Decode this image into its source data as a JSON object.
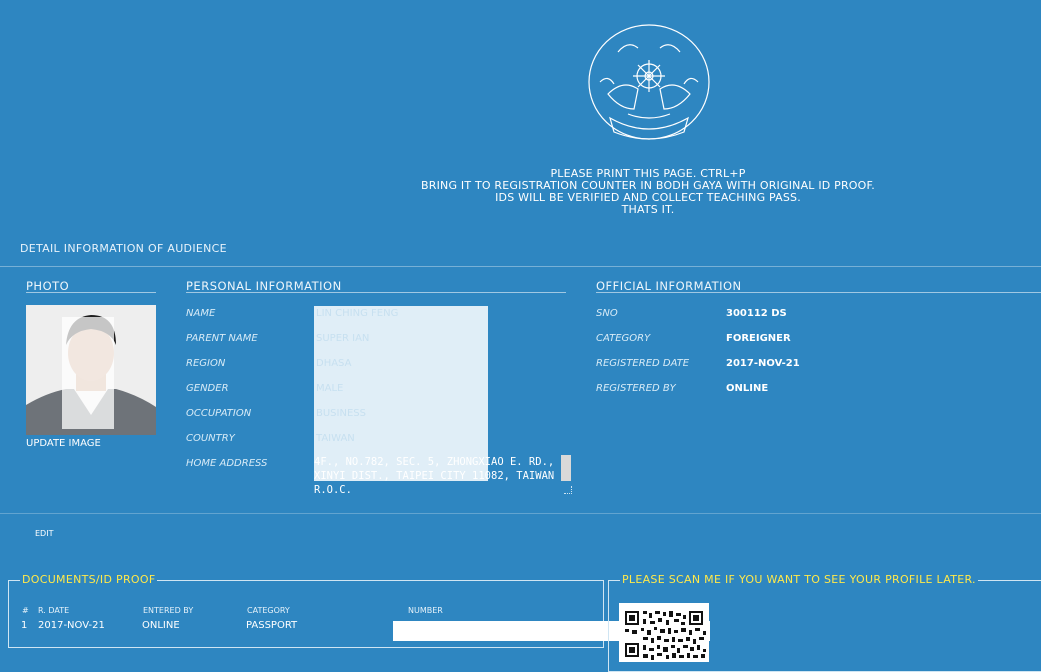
{
  "header": {
    "logo": "emblem-seal",
    "notice_lines": [
      "PLEASE PRINT THIS PAGE. CTRL+P",
      "BRING IT TO REGISTRATION COUNTER IN BODH GAYA WITH ORIGINAL ID PROOF.",
      "IDS WILL BE VERIFIED AND COLLECT TEACHING PASS.",
      "THATS IT."
    ]
  },
  "detail": {
    "title": "DETAIL INFORMATION OF AUDIENCE"
  },
  "photo": {
    "heading": "PHOTO",
    "update_label": "UPDATE IMAGE"
  },
  "personal": {
    "heading": "PERSONAL INFORMATION",
    "fields": [
      {
        "label": "NAME",
        "value": "LIN CHING FENG"
      },
      {
        "label": "PARENT NAME",
        "value": "SUPER IAN"
      },
      {
        "label": "REGION",
        "value": "DHASA"
      },
      {
        "label": "GENDER",
        "value": "MALE"
      },
      {
        "label": "OCCUPATION",
        "value": "BUSINESS"
      },
      {
        "label": "COUNTRY",
        "value": "TAIWAN"
      },
      {
        "label": "HOME ADDRESS",
        "value": ""
      }
    ],
    "home_address": "4F., NO.782, SEC. 5, ZHONGXIAO E. RD., XINYI DIST., TAIPEI CITY 11082, TAIWAN R.O.C."
  },
  "official": {
    "heading": "OFFICIAL INFORMATION",
    "fields": [
      {
        "label": "SNO",
        "value": "300112 DS"
      },
      {
        "label": "CATEGORY",
        "value": "FOREIGNER"
      },
      {
        "label": "REGISTERED DATE",
        "value": "2017-NOV-21"
      },
      {
        "label": "REGISTERED BY",
        "value": "ONLINE"
      }
    ]
  },
  "edit": {
    "label": "EDIT"
  },
  "documents": {
    "legend": "DOCUMENTS/ID PROOF",
    "columns": [
      "#",
      "R. DATE",
      "ENTERED BY",
      "CATEGORY",
      "NUMBER"
    ],
    "rows": [
      {
        "num": "1",
        "date": "2017-NOV-21",
        "entered_by": "ONLINE",
        "category": "PASSPORT",
        "number": ""
      }
    ]
  },
  "scan": {
    "legend": "PLEASE SCAN ME IF YOU WANT TO SEE YOUR PROFILE LATER.",
    "qr": "qr-code"
  },
  "colors": {
    "background": "#2e86c1",
    "legend_yellow": "#ffe94a",
    "redaction": "#e0eef7"
  }
}
